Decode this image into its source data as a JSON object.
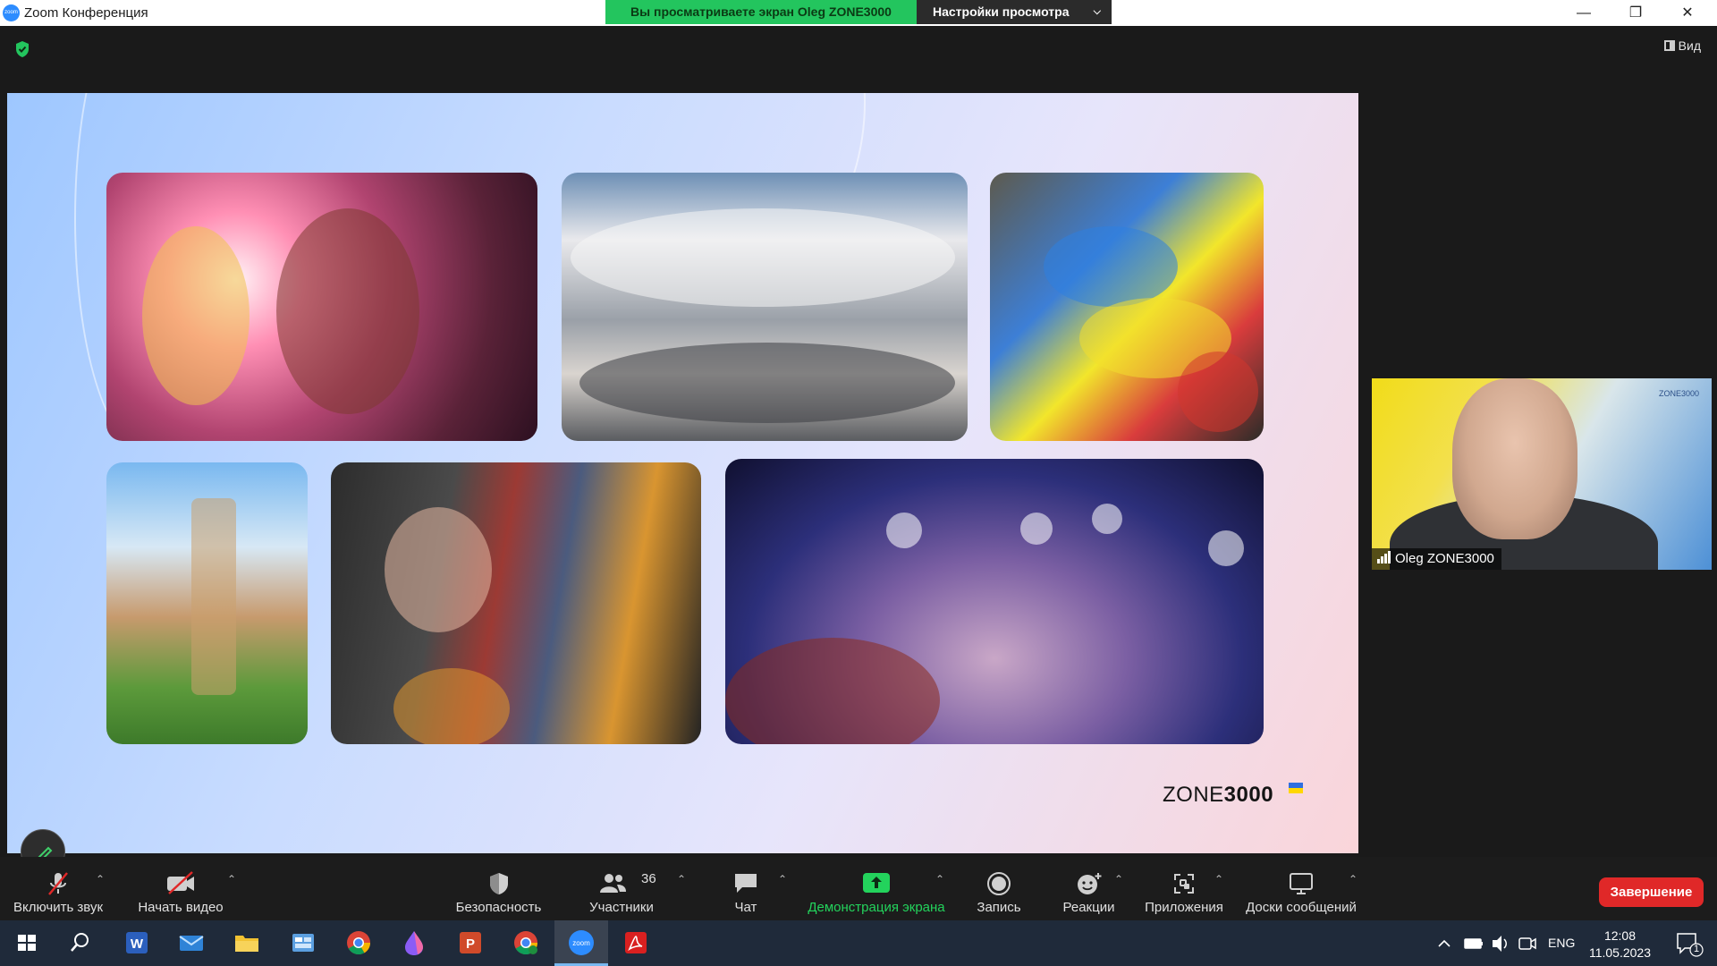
{
  "window": {
    "title": "Zoom Конференция",
    "app_icon_text": "zoom",
    "viewing_banner": "Вы просматриваете экран Oleg ZONE3000",
    "view_options": "Настройки просмотра",
    "minimize": "—",
    "restore": "❐",
    "close": "✕"
  },
  "meeting": {
    "view_button": "Вид",
    "slide": {
      "logo_regular": "ZONE",
      "logo_bold": "3000"
    },
    "participant_video": {
      "name": "Oleg ZONE3000",
      "brand": "ZONE3000"
    }
  },
  "controls": {
    "unmute": "Включить звук",
    "start_video": "Начать видео",
    "security": "Безопасность",
    "participants": "Участники",
    "participants_count": "36",
    "chat": "Чат",
    "share_screen": "Демонстрация экрана",
    "record": "Запись",
    "reactions": "Реакции",
    "apps": "Приложения",
    "whiteboards": "Доски сообщений",
    "end": "Завершение",
    "share_color": "#23d35c",
    "end_color": "#e02828"
  },
  "taskbar": {
    "language": "ENG",
    "time": "12:08",
    "date": "11.05.2023",
    "notification_count": "1",
    "zoom_label": "zoom",
    "apps": [
      "start-icon",
      "search-icon",
      "word-icon",
      "mail-icon",
      "file-explorer-icon",
      "control-panel-icon",
      "chrome-icon",
      "paint-drop-icon",
      "powerpoint-icon",
      "chrome-alt-icon",
      "zoom-icon",
      "acrobat-icon"
    ]
  }
}
